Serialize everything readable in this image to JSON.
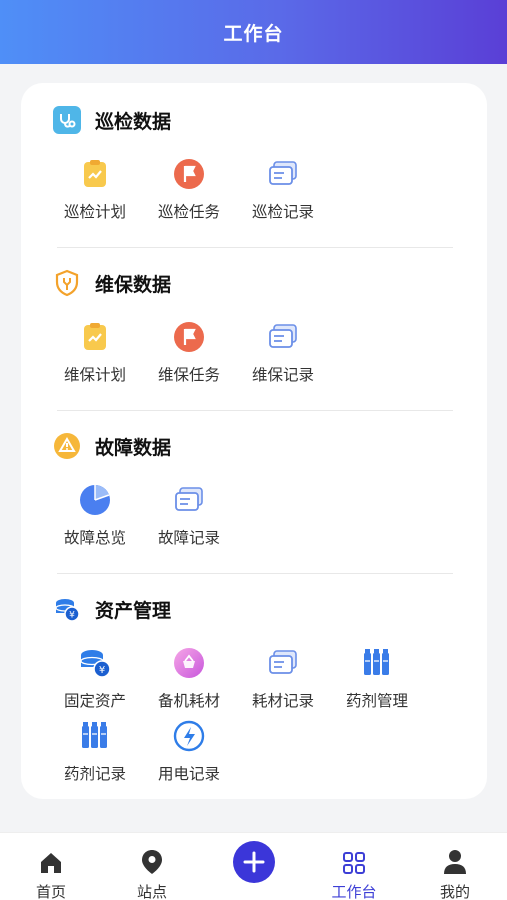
{
  "header": {
    "title": "工作台"
  },
  "sections": [
    {
      "title": "巡检数据",
      "icon": "stethoscope-icon",
      "items": [
        {
          "label": "巡检计划",
          "icon": "clipboard-plan-icon"
        },
        {
          "label": "巡检任务",
          "icon": "task-flag-icon"
        },
        {
          "label": "巡检记录",
          "icon": "record-list-icon"
        }
      ]
    },
    {
      "title": "维保数据",
      "icon": "shield-wrench-icon",
      "items": [
        {
          "label": "维保计划",
          "icon": "clipboard-plan-icon"
        },
        {
          "label": "维保任务",
          "icon": "task-flag-icon"
        },
        {
          "label": "维保记录",
          "icon": "record-list-icon"
        }
      ]
    },
    {
      "title": "故障数据",
      "icon": "warning-icon",
      "items": [
        {
          "label": "故障总览",
          "icon": "pie-chart-icon"
        },
        {
          "label": "故障记录",
          "icon": "record-list-icon"
        }
      ]
    },
    {
      "title": "资产管理",
      "icon": "coins-stack-icon",
      "items": [
        {
          "label": "固定资产",
          "icon": "coins-stack-icon"
        },
        {
          "label": "备机耗材",
          "icon": "spare-machine-icon"
        },
        {
          "label": "耗材记录",
          "icon": "record-list-icon"
        },
        {
          "label": "药剂管理",
          "icon": "bottles-icon"
        },
        {
          "label": "药剂记录",
          "icon": "bottles-icon"
        },
        {
          "label": "用电记录",
          "icon": "lightning-icon"
        }
      ]
    }
  ],
  "tabbar": [
    {
      "label": "首页",
      "icon": "home-icon",
      "active": false
    },
    {
      "label": "站点",
      "icon": "location-pin-icon",
      "active": false
    },
    {
      "label": "",
      "icon": "plus-icon",
      "active": false
    },
    {
      "label": "工作台",
      "icon": "grid-icon",
      "active": true
    },
    {
      "label": "我的",
      "icon": "user-icon",
      "active": false
    }
  ],
  "colors": {
    "accent": "#3b36d9",
    "header_start": "#4f8ff7",
    "header_end": "#5a3fd6"
  }
}
